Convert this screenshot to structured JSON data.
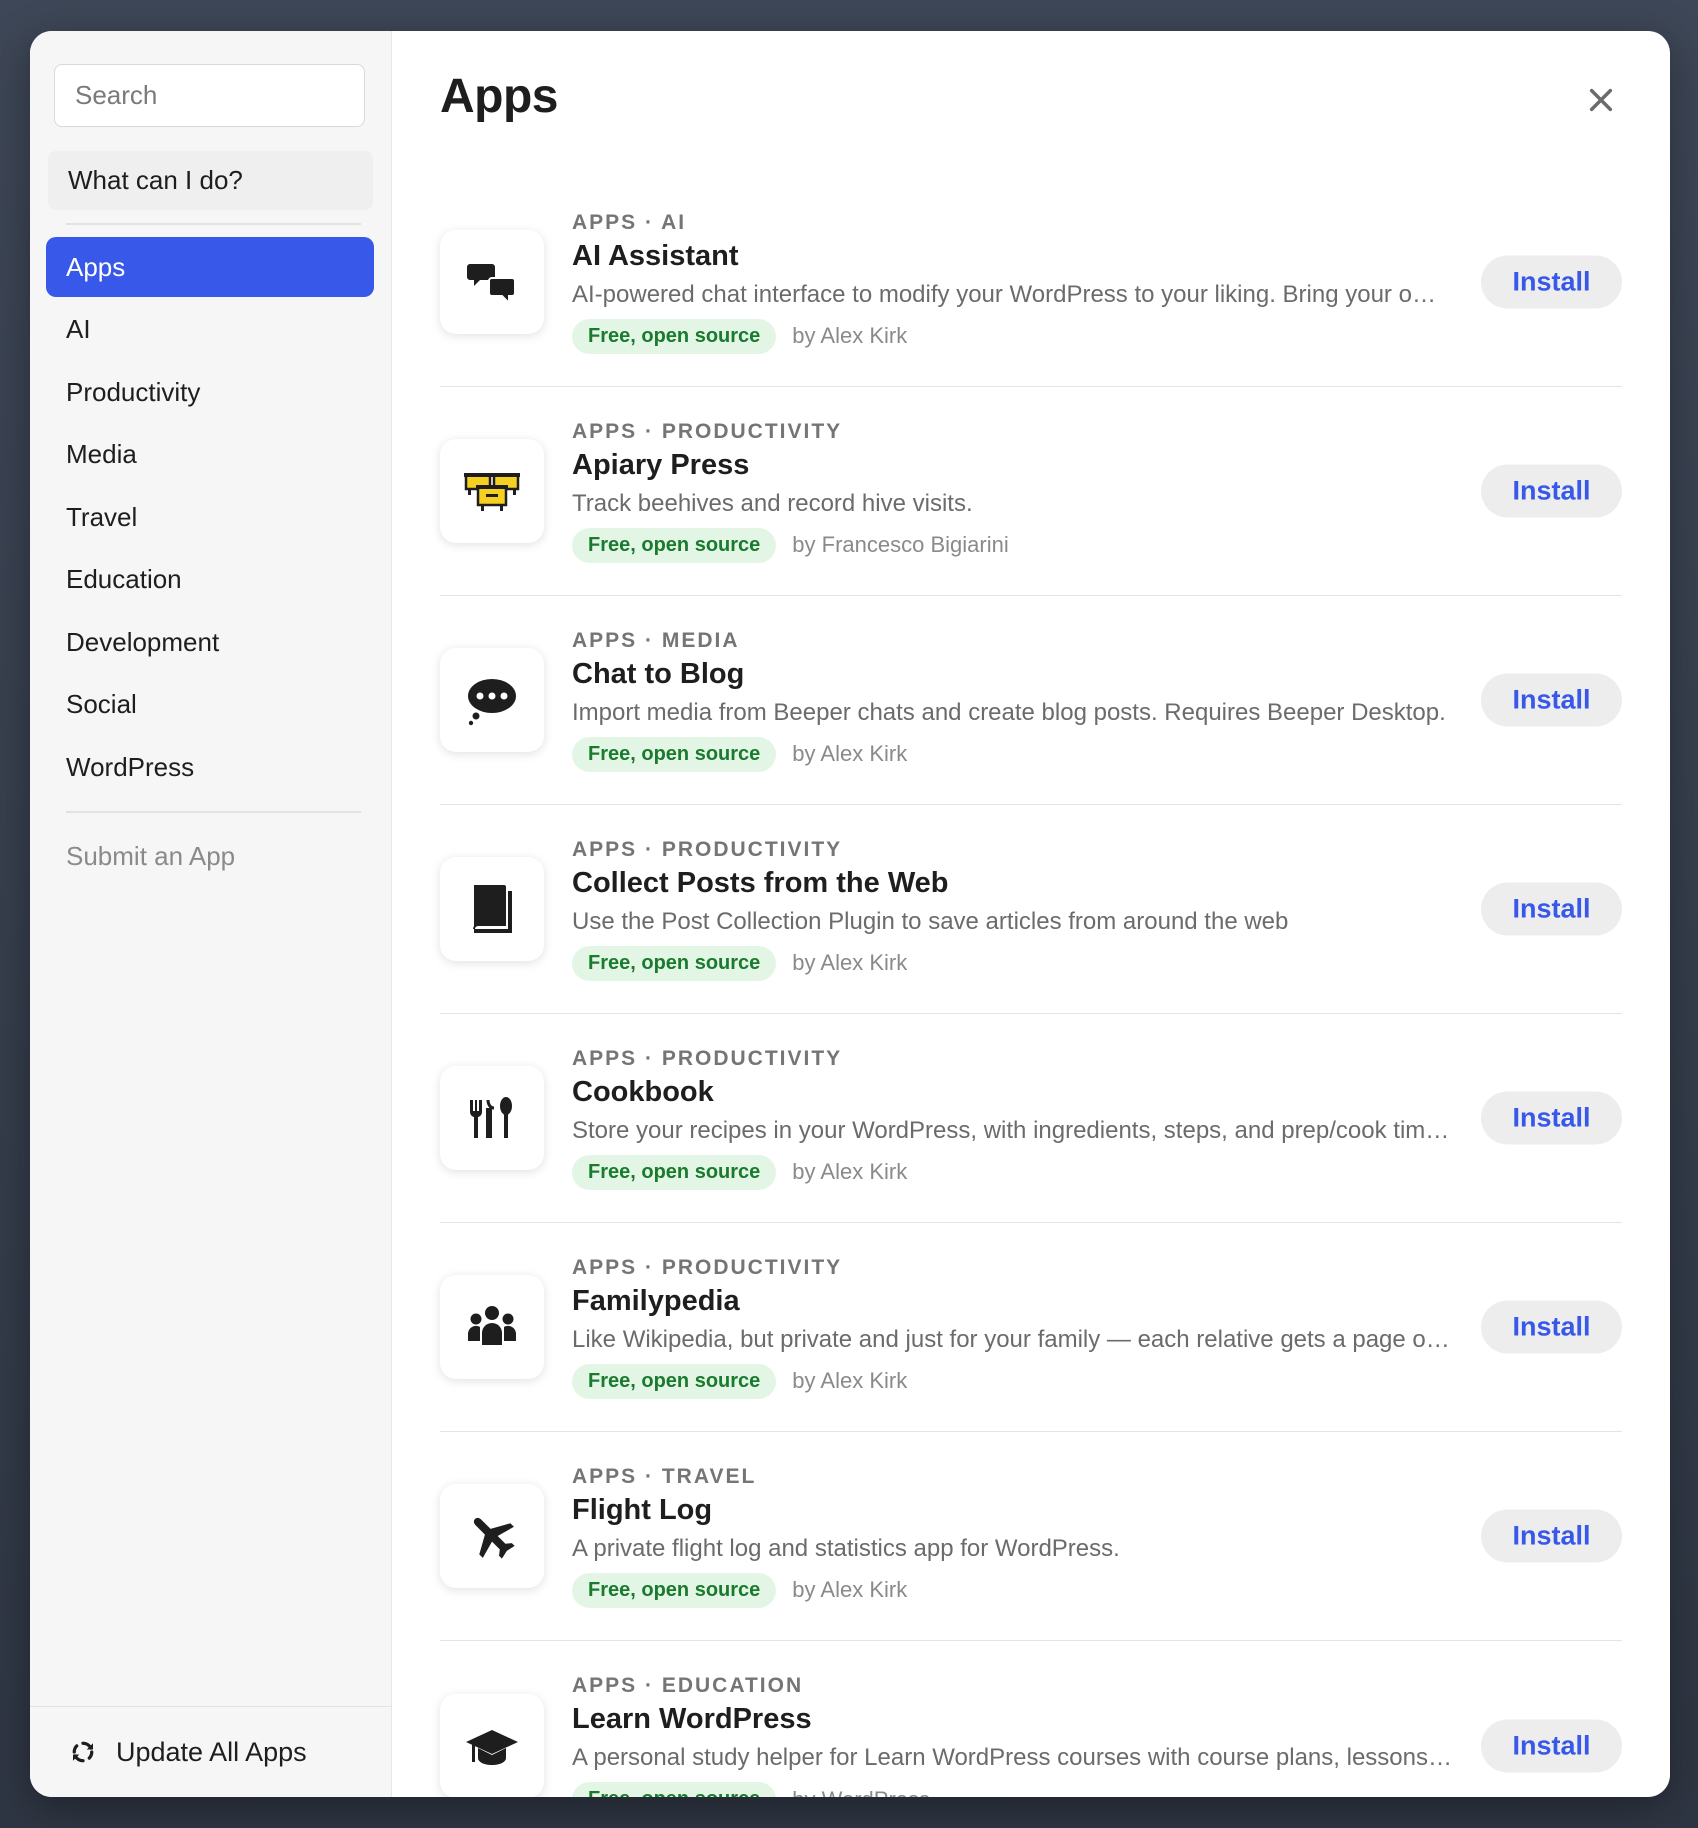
{
  "sidebar": {
    "search_placeholder": "Search",
    "what_can_i_do": "What can I do?",
    "nav": [
      "Apps",
      "AI",
      "Productivity",
      "Media",
      "Travel",
      "Education",
      "Development",
      "Social",
      "WordPress"
    ],
    "active_nav": "Apps",
    "submit_app": "Submit an App",
    "update_all": "Update All Apps"
  },
  "main": {
    "title": "Apps",
    "install_label": "Install",
    "apps": [
      {
        "category": "APPS · AI",
        "name": "AI Assistant",
        "description": "AI-powered chat interface to modify your WordPress to your liking. Bring your own API key.",
        "badge": "Free, open source",
        "author": "by Alex Kirk",
        "icon": "chat-bubbles-icon"
      },
      {
        "category": "APPS · PRODUCTIVITY",
        "name": "Apiary Press",
        "description": "Track beehives and record hive visits.",
        "badge": "Free, open source",
        "author": "by Francesco Bigiarini",
        "icon": "beehive-icon"
      },
      {
        "category": "APPS · MEDIA",
        "name": "Chat to Blog",
        "description": "Import media from Beeper chats and create blog posts. Requires Beeper Desktop.",
        "badge": "Free, open source",
        "author": "by Alex Kirk",
        "icon": "speech-bubble-icon"
      },
      {
        "category": "APPS · PRODUCTIVITY",
        "name": "Collect Posts from the Web",
        "description": "Use the Post Collection Plugin to save articles from around the web",
        "badge": "Free, open source",
        "author": "by Alex Kirk",
        "icon": "book-icon"
      },
      {
        "category": "APPS · PRODUCTIVITY",
        "name": "Cookbook",
        "description": "Store your recipes in your WordPress, with ingredients, steps, and prep/cook times.",
        "badge": "Free, open source",
        "author": "by Alex Kirk",
        "icon": "utensils-icon"
      },
      {
        "category": "APPS · PRODUCTIVITY",
        "name": "Familypedia",
        "description": "Like Wikipedia, but private and just for your family — each relative gets a page of their own.",
        "badge": "Free, open source",
        "author": "by Alex Kirk",
        "icon": "people-icon"
      },
      {
        "category": "APPS · TRAVEL",
        "name": "Flight Log",
        "description": "A private flight log and statistics app for WordPress.",
        "badge": "Free, open source",
        "author": "by Alex Kirk",
        "icon": "airplane-icon"
      },
      {
        "category": "APPS · EDUCATION",
        "name": "Learn WordPress",
        "description": "A personal study helper for Learn WordPress courses with course plans, lessons and progress.",
        "badge": "Free, open source",
        "author": "by WordPress",
        "icon": "graduation-cap-icon"
      }
    ]
  },
  "colors": {
    "accent": "#3858e9",
    "badge_bg": "#e3f6e6",
    "badge_text": "#1a7a2e",
    "icon_yellow": "#f5d020"
  }
}
